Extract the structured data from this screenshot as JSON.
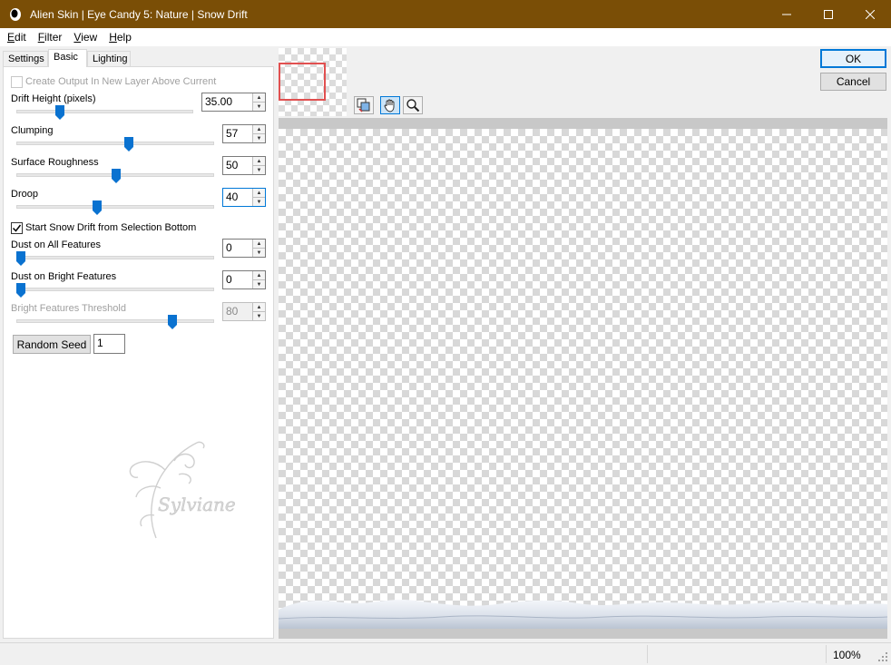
{
  "window": {
    "title": "Alien Skin | Eye Candy 5: Nature | Snow Drift",
    "titlebar_color": "#7a4e06"
  },
  "menu": [
    {
      "key": "E",
      "rest": "dit"
    },
    {
      "key": "F",
      "rest": "ilter"
    },
    {
      "key": "V",
      "rest": "iew"
    },
    {
      "key": "H",
      "rest": "elp"
    }
  ],
  "tabs": [
    "Settings",
    "Basic",
    "Lighting"
  ],
  "active_tab": "Basic",
  "controls": {
    "create_output_label": "Create Output In New Layer Above Current",
    "create_output_checked": false,
    "drift_height": {
      "label": "Drift Height (pixels)",
      "value": "35.00",
      "slider_fraction": 0.24
    },
    "clumping": {
      "label": "Clumping",
      "value": "57",
      "slider_fraction": 0.57
    },
    "surface_roughness": {
      "label": "Surface Roughness",
      "value": "50",
      "slider_fraction": 0.5
    },
    "droop": {
      "label": "Droop",
      "value": "40",
      "slider_fraction": 0.4
    },
    "start_from_selection_label": "Start Snow Drift from Selection Bottom",
    "start_from_selection_checked": true,
    "dust_all": {
      "label": "Dust on All Features",
      "value": "0",
      "slider_fraction": 0.0
    },
    "dust_bright": {
      "label": "Dust on Bright Features",
      "value": "0",
      "slider_fraction": 0.0
    },
    "bright_threshold": {
      "label": "Bright Features Threshold",
      "value": "80",
      "slider_fraction": 0.8,
      "disabled": true
    },
    "random_seed_label": "Random Seed",
    "random_seed_value": "1"
  },
  "watermark_text": "Sylviane",
  "buttons": {
    "ok": "OK",
    "cancel": "Cancel"
  },
  "status": {
    "zoom": "100%"
  },
  "colors": {
    "accent": "#0078d7",
    "thumb_frame": "#e15050",
    "slider_thumb": "#0a72d0"
  }
}
